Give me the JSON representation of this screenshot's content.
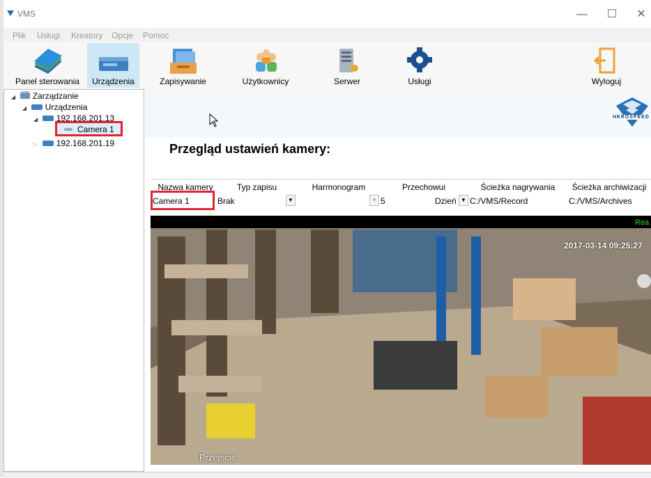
{
  "window": {
    "title": "VMS",
    "minimize": "—",
    "maximize": "☐",
    "close": "✕"
  },
  "menu": [
    "Plik",
    "Usługi",
    "Kreatory",
    "Opcje",
    "Pomoc"
  ],
  "toolbar": {
    "items": [
      "Panel sterowania",
      "Urządzenia",
      "Zapisywanie",
      "Użytkownicy",
      "Serwer",
      "Usługi"
    ],
    "active": "Urządzenia",
    "logout": "Wyloguj"
  },
  "tree": {
    "root": "Zarządzanie",
    "devices": "Urządzenia",
    "server1": "192.168.201.13",
    "camera": "Camera 1",
    "server2": "192.168.201.19"
  },
  "brand": "HEROSPEED",
  "section_title": "Przegląd ustawień kamery:",
  "grid": {
    "headers": [
      "Nazwa kamery",
      "Typ zapisu",
      "Harmonogram",
      "Przechowui",
      "Ścieżka nagrywania",
      "Ścieżka archiwizacji"
    ],
    "values": {
      "camera_name": "Camera 1",
      "record_type": "Brak",
      "schedule": "",
      "retention_value": "5",
      "retention_unit": "Dzień",
      "record_path": "C:/VMS/Record",
      "archive_path": "C:/VMS/Archives"
    }
  },
  "video": {
    "timestamp": "2017-03-14 09:25:27",
    "label_top_right": "Rea",
    "overlay_bottom": "Przejście"
  },
  "colors": {
    "highlight": "#e0242f",
    "active_tab": "#cde8f7",
    "accent": "#1a6fb5"
  }
}
